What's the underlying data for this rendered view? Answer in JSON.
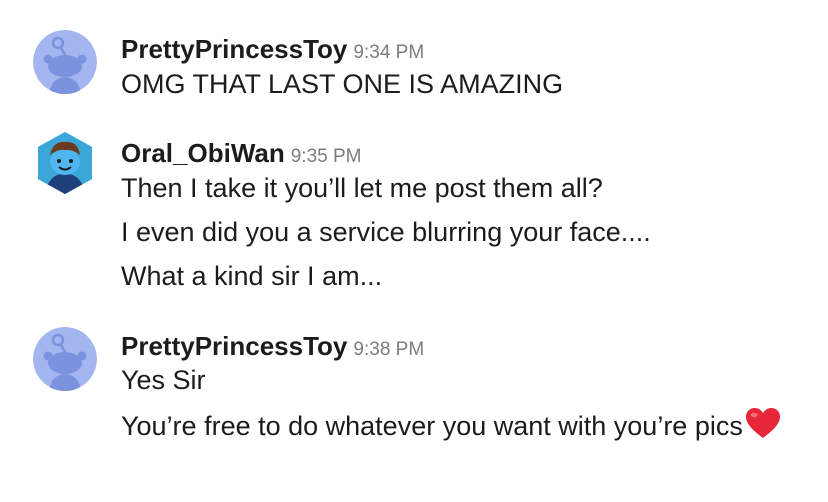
{
  "messages": [
    {
      "username": "PrettyPrincessToy",
      "time": "9:34 PM",
      "avatar_icon": "snoo-default-avatar-icon",
      "lines": [
        "OMG THAT LAST ONE IS AMAZING"
      ]
    },
    {
      "username": "Oral_ObiWan",
      "time": "9:35 PM",
      "avatar_icon": "custom-snoo-avatar-icon",
      "lines": [
        "Then I take it you’ll let me post them all?",
        "I even did you a service blurring your face....",
        "What a kind sir I am..."
      ]
    },
    {
      "username": "PrettyPrincessToy",
      "time": "9:38 PM",
      "avatar_icon": "snoo-default-avatar-icon",
      "lines": [
        "Yes Sir",
        "You’re free to do whatever you want with you’re pics"
      ],
      "emoji": "heart-emoji-icon"
    }
  ],
  "colors": {
    "avatar_default_bg": "#a3b6f0",
    "avatar_default_fg": "#7b92de",
    "avatar_custom_bg": "#2ab3c8",
    "heart": "#e8263a",
    "timestamp": "#7c7c7c"
  }
}
